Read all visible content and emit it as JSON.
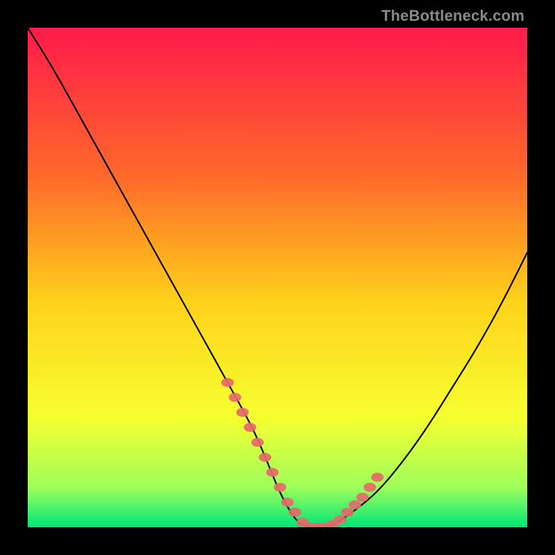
{
  "watermark": "TheBottleneck.com",
  "chart_data": {
    "type": "line",
    "title": "",
    "xlabel": "",
    "ylabel": "",
    "xlim": [
      0,
      100
    ],
    "ylim": [
      0,
      100
    ],
    "series": [
      {
        "name": "bottleneck-curve",
        "x": [
          0,
          5,
          10,
          15,
          20,
          25,
          30,
          35,
          40,
          45,
          48,
          50,
          52,
          54,
          56,
          58,
          60,
          62,
          65,
          70,
          75,
          80,
          85,
          90,
          95,
          100
        ],
        "y": [
          100,
          92,
          83,
          74,
          65,
          56,
          47,
          38,
          29,
          20,
          13,
          8,
          4,
          1,
          0,
          0,
          0,
          1,
          3,
          7,
          13,
          20,
          28,
          36,
          45,
          55
        ]
      }
    ],
    "highlight_dots": {
      "name": "highlight-dots",
      "x": [
        40,
        41.5,
        43,
        44.5,
        46,
        47.5,
        49,
        50.5,
        52,
        53.5,
        55,
        56.5,
        58,
        59.5,
        61,
        62.5,
        64,
        65.5,
        67,
        68.5,
        70
      ],
      "y": [
        29,
        26,
        23,
        20,
        17,
        14,
        11,
        8,
        5,
        3,
        1,
        0,
        0,
        0,
        0.5,
        1.5,
        3,
        4.5,
        6,
        8,
        10
      ]
    },
    "gradient": {
      "top": "#ff1a4b",
      "upper_mid": "#ff6a2a",
      "mid": "#ffd21a",
      "lower_mid": "#f6ff30",
      "near_bottom": "#9eff5a",
      "bottom": "#00e676"
    },
    "curve_stroke": "#000000",
    "dot_color": "#e46a6a"
  }
}
